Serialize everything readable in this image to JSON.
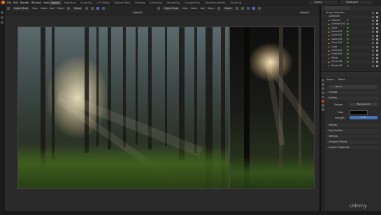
{
  "topbar": {
    "menus": [
      "File",
      "Edit",
      "Render",
      "Window",
      "Help"
    ],
    "workspaces": [
      "Layout",
      "Modeling",
      "Sculpting",
      "UV Editing",
      "Texture Paint",
      "Shading",
      "Animation",
      "Rendering",
      "Compositing",
      "Geometry Nodes",
      "Scripting"
    ],
    "active_workspace": "Layout",
    "scene": "Scene",
    "view_layer": "ViewLayer"
  },
  "editor_left": {
    "mode": "Object Mode",
    "menus": [
      "View",
      "Select",
      "Add",
      "Object"
    ],
    "transform": "Global",
    "options_label": "Options"
  },
  "editor_right": {
    "mode": "Object Mode",
    "menus": [
      "View",
      "Select",
      "Add",
      "Object"
    ],
    "transform": "Global",
    "options_label": "Options"
  },
  "outliner": {
    "collection_root": "Scene Collection",
    "collection": "Collection",
    "items": [
      "Camera",
      "Camera.001",
      "Cone",
      "Cone.001",
      "Cone.002",
      "Cone.003",
      "Cone.004",
      "Cube",
      "Cube.001",
      "Cube.002",
      "Plane",
      "Plane.001",
      "Plane.002"
    ]
  },
  "properties": {
    "breadcrumb": [
      "Scene",
      "World"
    ],
    "world_name": "World",
    "panels": {
      "preview": "Preview",
      "surface": "Surface",
      "surface_label": "Surface",
      "surface_value": "Background",
      "color_label": "Color",
      "strength_label": "Strength",
      "strength_value": "0.700",
      "volume": "Volume",
      "ray_visibility": "Ray Visibility",
      "settings": "Settings",
      "viewport_display": "Viewport Display",
      "custom_properties": "Custom Properties"
    }
  },
  "watermark": "Udemy",
  "colors": {
    "accent": "#4772b3",
    "brand_orange": "#e87d0d",
    "panel_bg": "#2b2b2b",
    "window_bg": "#1d1d1d"
  }
}
